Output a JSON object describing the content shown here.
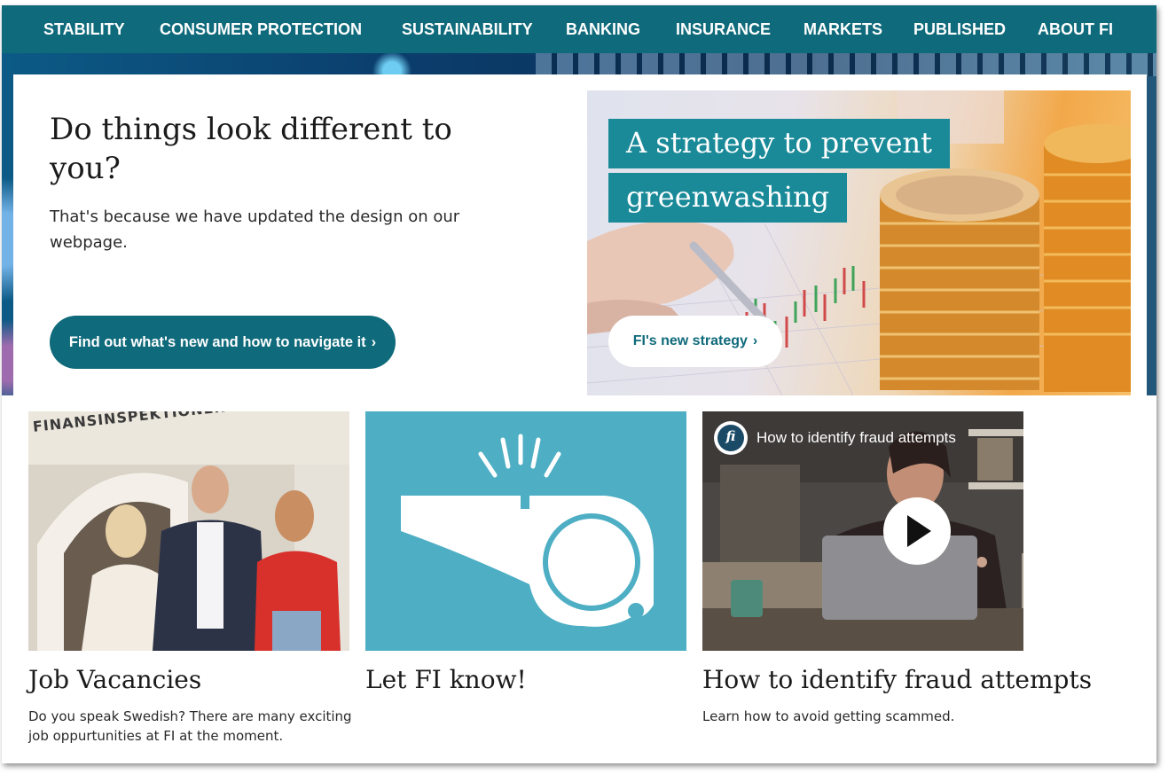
{
  "nav": {
    "items": [
      {
        "label": "STABILITY"
      },
      {
        "label": "CONSUMER PROTECTION"
      },
      {
        "label": "SUSTAINABILITY"
      },
      {
        "label": "BANKING"
      },
      {
        "label": "INSURANCE"
      },
      {
        "label": "MARKETS"
      },
      {
        "label": "PUBLISHED"
      },
      {
        "label": "ABOUT FI"
      }
    ],
    "background": "#0f6a7b"
  },
  "hero": {
    "title": "Do things look different to you?",
    "text": "That's because we have updated the design on our webpage.",
    "button_label": "Find out what's new and how to navigate it",
    "chevron": "›"
  },
  "promo": {
    "title_line1": "A strategy to prevent",
    "title_line2": "greenwashing",
    "button_label": "FI's new strategy",
    "chevron": "›",
    "label_color": "#1a8a99"
  },
  "cards": [
    {
      "title": "Job Vacancies",
      "text": "Do you speak Swedish? There are many exciting job oppurtunities at FI at the moment.",
      "sign_text": "FINANSINSPEKTIONEN"
    },
    {
      "title": "Let FI know!",
      "icon": "whistle-icon",
      "background": "#4daec4"
    },
    {
      "title": "How to identify fraud attempts",
      "text": "Learn how to avoid getting scammed.",
      "video_title": "How to identify fraud attempts",
      "channel_logo": "fi"
    }
  ],
  "colors": {
    "primary": "#0f6a7b",
    "teal_light": "#4daec4"
  }
}
